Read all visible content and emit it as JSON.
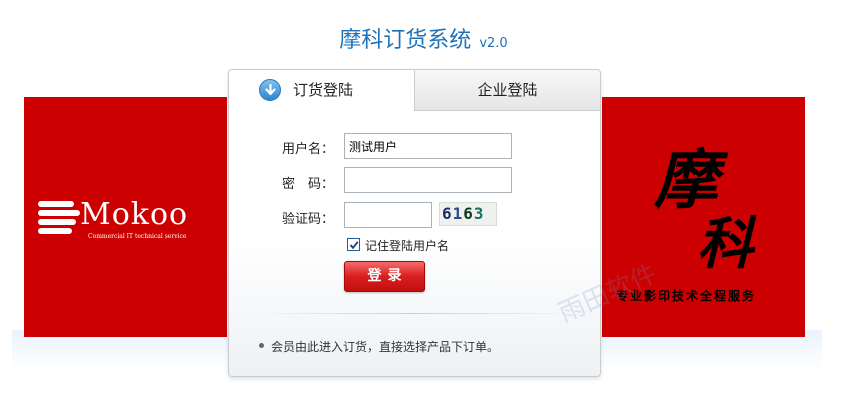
{
  "header": {
    "title": "摩科订货系统",
    "version": "v2.0"
  },
  "left_banner": {
    "logo_text": "Mokoo",
    "logo_subtext": "Commercial IT technical service"
  },
  "right_banner": {
    "char1": "摩",
    "char2": "科",
    "slogan": "专业影印技术全程服务"
  },
  "tabs": [
    {
      "label": "订货登陆",
      "icon": "download-arrow-icon",
      "active": true
    },
    {
      "label": "企业登陆",
      "active": false
    }
  ],
  "form": {
    "username_label": "用户名：",
    "username_value": "测试用户",
    "password_label": "密　码：",
    "password_value": "",
    "captcha_label": "验证码：",
    "captcha_value": "",
    "captcha_text": [
      "6",
      "1",
      "6",
      "3"
    ],
    "remember_label": "记住登陆用户名",
    "remember_checked": true,
    "login_button": "登录"
  },
  "note": "会员由此进入订货，直接选择产品下订单。",
  "watermark": "雨田软件",
  "colors": {
    "title_blue": "#1e72b8",
    "banner_red": "#cc0000",
    "button_red": "#d91e1e"
  }
}
